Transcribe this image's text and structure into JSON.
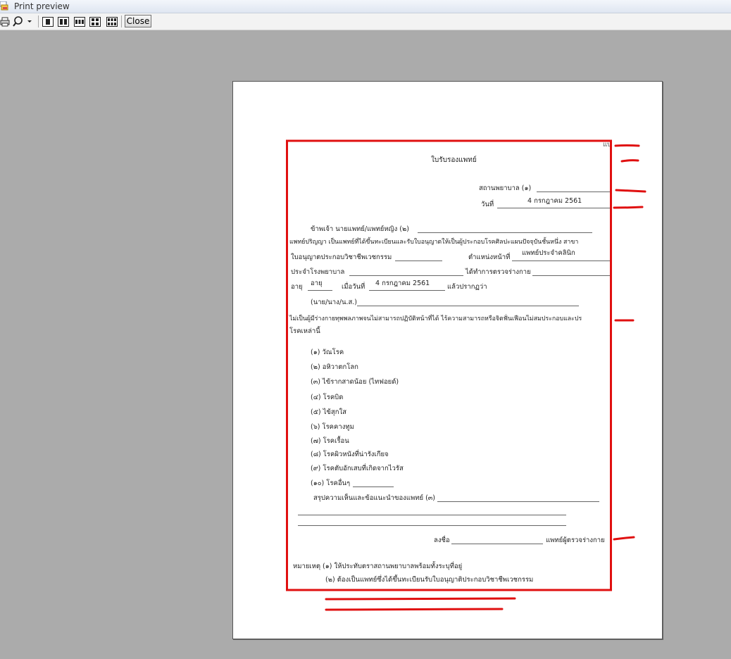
{
  "window": {
    "title": "Print preview"
  },
  "toolbar": {
    "close_label": "Close",
    "icons": [
      "print-icon",
      "zoom-icon",
      "one-page-icon",
      "two-pages-icon",
      "three-pages-icon",
      "four-pages-icon",
      "six-pages-icon"
    ]
  },
  "document": {
    "corner_mark": "แบ",
    "title": "ใบรับรองแพทย์",
    "hospital_label": "สถานพยาบาล (๑)",
    "date_label": "วันที่",
    "date_value": "4 กรกฎาคม 2561",
    "doctor_line": "ข้าพเจ้า นายแพทย์/แพทย์หญิง (๒)",
    "degree_line": "แพทย์ปริญญา เป็นแพทย์ที่ได้ขึ้นทะเบียนและรับใบอนุญาตให้เป็นผู้ประกอบโรคศิลปะแผนปัจจุบันชั้นหนึ่ง สาขา",
    "license_label": "ใบอนุญาตประกอบวิชาชีพเวชกรรม",
    "position_label": "ตำแหน่งหน้าที่",
    "position_value": "แพทย์ประจำคลินิก",
    "hospital_staff_label": "ประจำโรงพยาบาล",
    "examined_label": "ได้ทำการตรวจร่างกาย",
    "age_label": "อายุ",
    "age_value": "อายุ",
    "when_label": "เมื่อวันที่",
    "when_value": "4 กรกฎาคม 2561",
    "appear_label": "แล้วปรากฏว่า",
    "title_prefix": "(นาย/นาง/น.ส.)",
    "statement_line1": "ไม่เป็นผู้มีร่างกายทุพพลภาพจนไม่สามารถปฏิบัติหน้าที่ได้ ไร้ความสามารถหรือจิตฟั่นเฟือนไม่สมประกอบและปร",
    "statement_line2": "โรคเหล่านี้",
    "diseases": [
      "(๑) วัณโรค",
      "(๒) อหิวาตกโลก",
      "(๓) ไข้รากสาดน้อย (ไทฟอยด์)",
      "(๔) โรคบิด",
      "(๕) ไข้สุกใส",
      "(๖) โรคคางทูม",
      "(๗) โรคเรื้อน",
      "(๘) โรคผิวหนังที่น่ารังเกียจ",
      "(๙) โรคตับอักเสบที่เกิดจากไวรัส",
      "(๑๐) โรคอื่นๆ"
    ],
    "summary_label": "สรุปความเห็นและข้อแนะนำของแพทย์ (๓)",
    "sign_label": "ลงชื่อ",
    "examiner_label": "แพทย์ผู้ตรวจร่างกาย",
    "note_label": "หมายเหตุ",
    "notes": [
      "(๑) ให้ประทับตราสถานพยาบาลพร้อมทั้งระบุที่อยู่",
      "(๒) ต้องเป็นแพทย์ซึ่งได้ขึ้นทะเบียนรับใบอนุญาติประกอบวิชาชีพเวชกรรม"
    ]
  },
  "annotation_color": "#e01010"
}
